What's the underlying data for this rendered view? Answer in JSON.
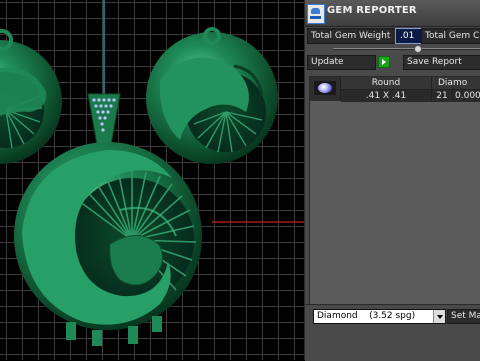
{
  "panel": {
    "title": "GEM REPORTER",
    "total_gem_weight_label": "Total Gem Weight",
    "total_gem_weight_value": ".01",
    "total_gem_count_label": "Total Gem C",
    "slider_level": 0.57,
    "update_label": "Update",
    "save_report_label": "Save Report",
    "table": {
      "columns": [
        "Round",
        "Diamo"
      ],
      "rows": [
        {
          "size": ".41 X .41",
          "count": "21",
          "weight": "0.000"
        }
      ]
    },
    "material_select": "Diamond    (3.52 spg)",
    "set_material_label": "Set Mat"
  },
  "viewport": {
    "grid_color": "#3b3b3b",
    "model_color": "#1a6b45",
    "axis_red": "#c02020",
    "axis_cyan": "#2bb7c9"
  },
  "colors": {
    "panel_bg": "#4a4a4a",
    "input_blue": "#0c1a45",
    "update_green": "#19a319"
  }
}
